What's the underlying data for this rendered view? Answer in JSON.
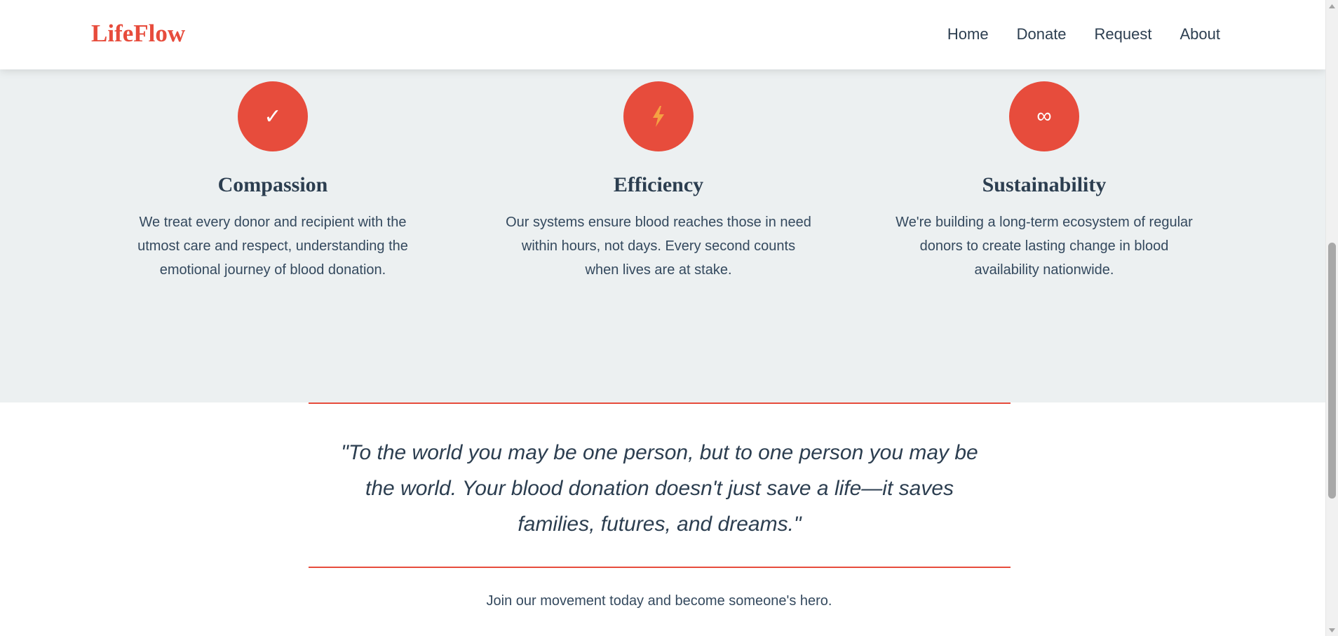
{
  "header": {
    "logo": "LifeFlow",
    "nav": [
      {
        "label": "Home"
      },
      {
        "label": "Donate"
      },
      {
        "label": "Request"
      },
      {
        "label": "About"
      }
    ]
  },
  "values": [
    {
      "icon": "checkmark-icon",
      "icon_glyph": "✓",
      "title": "Compassion",
      "text": "We treat every donor and recipient with the utmost care and respect, understanding the emotional journey of blood donation."
    },
    {
      "icon": "lightning-icon",
      "icon_glyph": "",
      "title": "Efficiency",
      "text": "Our systems ensure blood reaches those in need within hours, not days. Every second counts when lives are at stake."
    },
    {
      "icon": "infinity-icon",
      "icon_glyph": "∞",
      "title": "Sustainability",
      "text": "We're building a long-term ecosystem of regular donors to create lasting change in blood availability nationwide."
    }
  ],
  "quote": {
    "text": "\"To the world you may be one person, but to one person you may be the world. Your blood donation doesn't just save a life—it saves families, futures, and dreams.\""
  },
  "cta": {
    "text": "Join our movement today and become someone's hero."
  },
  "colors": {
    "accent": "#e74c3c",
    "text_dark": "#2c3e50",
    "section_bg": "#ecf0f1",
    "lightning": "#f5a142"
  }
}
